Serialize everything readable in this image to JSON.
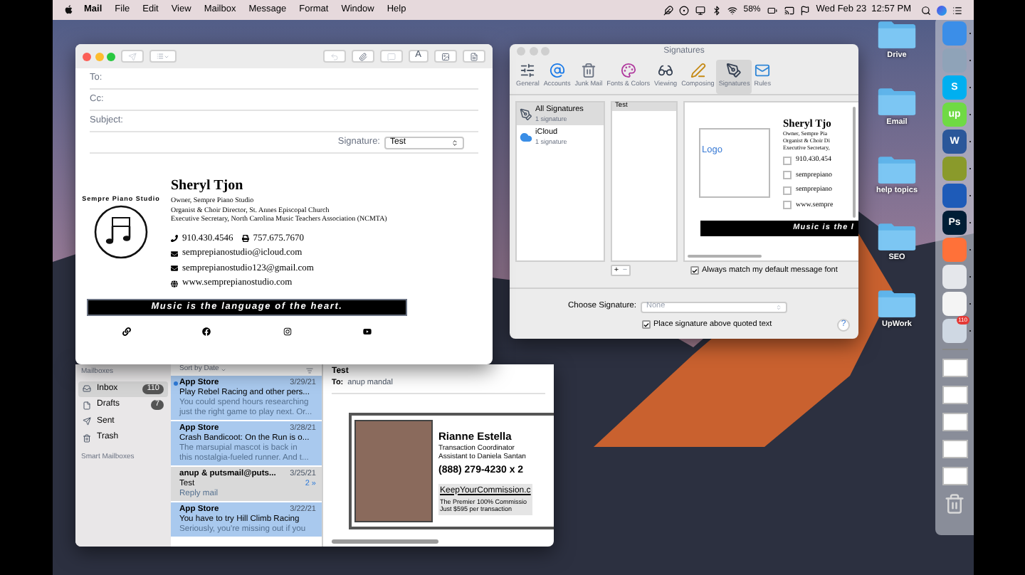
{
  "menu_bar": {
    "app": "Mail",
    "menus": [
      "File",
      "Edit",
      "View",
      "Mailbox",
      "Message",
      "Format",
      "Window",
      "Help"
    ],
    "battery": "58%",
    "datetime": "Wed Feb 23  12:57 PM"
  },
  "compose_window": {
    "fields": [
      {
        "label": "To:"
      },
      {
        "label": "Cc:"
      },
      {
        "label": "Subject:"
      }
    ],
    "format_button": "A",
    "signature_label": "Signature:",
    "signature_value": "Test",
    "signature": {
      "logo_text": "Sempre Piano Studio",
      "name": "Sheryl Tjon",
      "lines": [
        "Owner, Sempre Piano Studio",
        "Organist & Choir Director, St. Annes Episcopal Church",
        "Executive Secretary, North Carolina Music Teachers Association (NCMTA)"
      ],
      "contacts": [
        [
          {
            "kind": "phone",
            "text": "910.430.4546"
          },
          {
            "kind": "fax",
            "text": "757.675.7670"
          }
        ],
        [
          {
            "kind": "email",
            "text": "semprepianostudio@icloud.com"
          }
        ],
        [
          {
            "kind": "email",
            "text": "semprepianostudio123@gmail.com"
          }
        ],
        [
          {
            "kind": "web",
            "text": "www.semprepianostudio.com"
          }
        ]
      ],
      "tagline": "Music is the language of the heart.",
      "social": [
        {
          "kind": "link"
        },
        {
          "kind": "facebook"
        },
        {
          "kind": "instagram"
        },
        {
          "kind": "youtube"
        }
      ]
    }
  },
  "mail_window": {
    "sidebar": {
      "heading": "Mailboxes",
      "items": [
        {
          "kind": "inbox",
          "label": "Inbox",
          "count": "110",
          "selected": true
        },
        {
          "kind": "drafts",
          "label": "Drafts",
          "count": "7",
          "selected": false
        },
        {
          "kind": "sent",
          "label": "Sent",
          "selected": false
        },
        {
          "kind": "trash",
          "label": "Trash",
          "selected": false
        }
      ],
      "smart_heading": "Smart Mailboxes"
    },
    "sort_label": "Sort by Date",
    "messages": [
      {
        "sender": "App Store",
        "date": "3/29/21",
        "subject": "Play Rebel Racing and other pers...",
        "preview": [
          "You could spend hours researching",
          "just the right game to play next. Or..."
        ],
        "unread": true,
        "selected": true,
        "open": false
      },
      {
        "sender": "App Store",
        "date": "3/28/21",
        "subject": "Crash Bandicoot: On the Run is o...",
        "preview": [
          "The marsupial mascot is back in",
          "this nostalgia-fueled runner. And t..."
        ],
        "unread": false,
        "selected": true,
        "open": false
      },
      {
        "sender": "anup & putsmail@puts...",
        "date": "3/25/21",
        "subject": "Test",
        "thread": "2 »",
        "preview": [
          "Reply mail"
        ],
        "unread": false,
        "selected": false,
        "open": true
      },
      {
        "sender": "App Store",
        "date": "3/22/21",
        "subject": "You have to try Hill Climb Racing",
        "preview": [
          "Seriously, you're missing out if you"
        ],
        "unread": false,
        "selected": true,
        "open": false
      }
    ],
    "message": {
      "subject": "Test",
      "to_label": "To:",
      "to": "anup mandal",
      "card": {
        "name": "Rianne Estella",
        "lines": [
          "Transaction Coordinator",
          "Assistant to Daniela Santan"
        ],
        "phone": "(888) 279-4230 x 2",
        "link": "KeepYourCommission.c",
        "footer": [
          "The Premier 100% Commissio",
          "Just $595 per transaction"
        ]
      }
    }
  },
  "signatures_window": {
    "title": "Signatures",
    "tabs": [
      {
        "kind": "general",
        "label": "General",
        "selected": false
      },
      {
        "kind": "accounts",
        "label": "Accounts",
        "selected": false
      },
      {
        "kind": "junk",
        "label": "Junk Mail",
        "selected": false
      },
      {
        "kind": "fonts",
        "label": "Fonts & Colors",
        "selected": false
      },
      {
        "kind": "viewing",
        "label": "Viewing",
        "selected": false
      },
      {
        "kind": "composing",
        "label": "Composing",
        "selected": false
      },
      {
        "kind": "signatures",
        "label": "Signatures",
        "selected": true
      },
      {
        "kind": "rules",
        "label": "Rules",
        "selected": false
      }
    ],
    "accounts": [
      {
        "kind": "all",
        "name": "All Signatures",
        "count": "1 signature",
        "selected": true
      },
      {
        "kind": "icloud",
        "name": "iCloud",
        "count": "1 signature",
        "selected": false
      }
    ],
    "signature_list": [
      {
        "name": "Test",
        "selected": true
      }
    ],
    "preview": {
      "logo": "Logo",
      "name": "Sheryl Tjo",
      "lines": [
        "Owner, Sempre Pia",
        "Organist & Choir Di",
        "Executive Secretary,"
      ],
      "contacts": [
        "910.430.454",
        "semprepiano",
        "semprepiano",
        "www.sempre"
      ],
      "tagline": "Music is the l"
    },
    "add": "+",
    "remove": "−",
    "match_font": {
      "label": "Always match my default message font",
      "checked": true
    },
    "choose_label": "Choose Signature:",
    "choose_value": "None",
    "place_above": {
      "label": "Place signature above quoted text",
      "checked": true
    },
    "help": "?"
  },
  "desktop_folders": [
    "Drive",
    "Email",
    "help topics",
    "SEO",
    "UpWork"
  ],
  "dock": [
    {
      "kind": "app",
      "color": "#3b8ee8",
      "running": true
    },
    {
      "kind": "app",
      "color": "#8fa3b8",
      "running": true
    },
    {
      "kind": "app",
      "color": "#00aff0",
      "glyph": "S",
      "running": true
    },
    {
      "kind": "app",
      "color": "#6fda44",
      "glyph": "up",
      "running": true
    },
    {
      "kind": "app",
      "color": "#2b579a",
      "glyph": "W",
      "running": true
    },
    {
      "kind": "app",
      "color": "#8a9a2b",
      "running": true
    },
    {
      "kind": "app",
      "color": "#1e5bb8",
      "running": true
    },
    {
      "kind": "app",
      "color": "#001e36",
      "glyph": "Ps",
      "running": true
    },
    {
      "kind": "app",
      "color": "#ff7139",
      "running": true
    },
    {
      "kind": "app",
      "color": "#e5e7eb",
      "running": true
    },
    {
      "kind": "app",
      "color": "#f4f4f4",
      "running": true
    },
    {
      "kind": "app",
      "color": "#cfd8e3",
      "badge": "110",
      "running": true
    },
    {
      "kind": "separator"
    },
    {
      "kind": "window"
    },
    {
      "kind": "window"
    },
    {
      "kind": "window"
    },
    {
      "kind": "window"
    },
    {
      "kind": "window"
    },
    {
      "kind": "trash"
    }
  ]
}
